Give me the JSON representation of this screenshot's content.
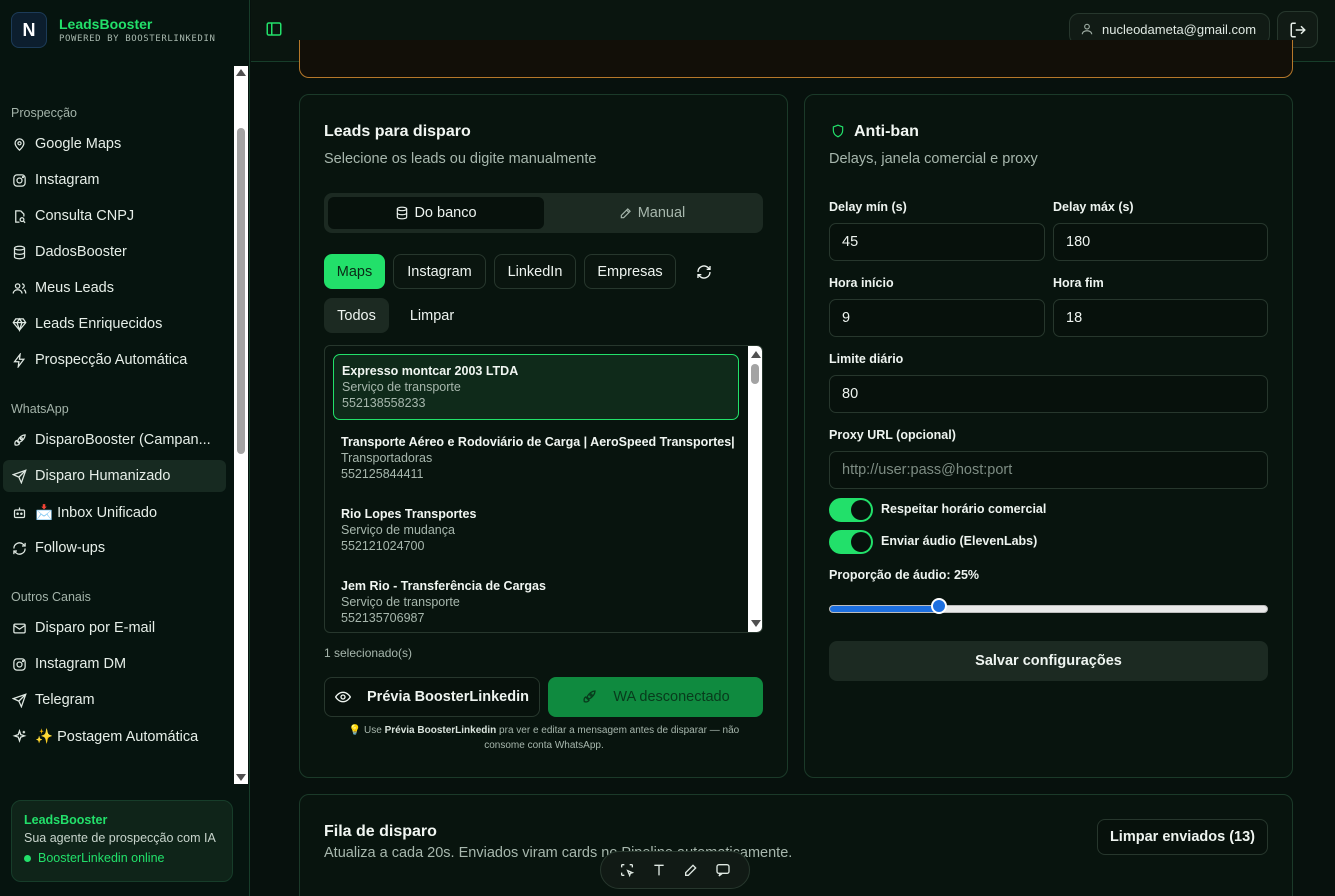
{
  "brand": {
    "logo_text": "N",
    "title": "LeadsBooster",
    "subtitle": "POWERED BY BOOSTERLINKEDIN"
  },
  "sidebar": {
    "sections": [
      {
        "label": "Prospecção",
        "items": [
          {
            "label": "Google Maps",
            "icon": "map-pin-icon"
          },
          {
            "label": "Instagram",
            "icon": "instagram-icon"
          },
          {
            "label": "Consulta CNPJ",
            "icon": "file-search-icon"
          },
          {
            "label": "DadosBooster",
            "icon": "database-icon"
          },
          {
            "label": "Meus Leads",
            "icon": "users-icon"
          },
          {
            "label": "Leads Enriquecidos",
            "icon": "gem-icon"
          },
          {
            "label": "Prospecção Automática",
            "icon": "zap-icon"
          }
        ]
      },
      {
        "label": "WhatsApp",
        "items": [
          {
            "label": "DisparoBooster (Campan...",
            "icon": "rocket-icon"
          },
          {
            "label": "Disparo Humanizado",
            "icon": "send-icon",
            "active": true
          },
          {
            "label": "📩 Inbox Unificado",
            "icon": "bot-icon"
          },
          {
            "label": "Follow-ups",
            "icon": "refresh-icon"
          }
        ]
      },
      {
        "label": "Outros Canais",
        "items": [
          {
            "label": "Disparo por E-mail",
            "icon": "mail-icon"
          },
          {
            "label": "Instagram DM",
            "icon": "instagram-icon"
          },
          {
            "label": "Telegram",
            "icon": "send-icon"
          },
          {
            "label": "✨ Postagem Automática",
            "icon": "sparkles-icon"
          }
        ]
      }
    ],
    "footer": {
      "title": "LeadsBooster",
      "text": "Sua agente de prospecção com IA",
      "status": "BoosterLinkedin online"
    }
  },
  "header": {
    "user_email": "nucleodameta@gmail.com"
  },
  "leads_card": {
    "title": "Leads para disparo",
    "subtitle": "Selecione os leads ou digite manualmente",
    "mode_db": "Do banco",
    "mode_manual": "Manual",
    "sources": [
      "Maps",
      "Instagram",
      "LinkedIn",
      "Empresas"
    ],
    "select_all": "Todos",
    "clear": "Limpar",
    "leads": [
      {
        "name": "Expresso montcar 2003 LTDA",
        "category": "Serviço de transporte",
        "phone": "552138558233",
        "selected": true
      },
      {
        "name": "Transporte Aéreo e Rodoviário de Carga | AeroSpeed Transportes|",
        "category": "Transportadoras",
        "phone": "552125844411"
      },
      {
        "name": "Rio Lopes Transportes",
        "category": "Serviço de mudança",
        "phone": "552121024700"
      },
      {
        "name": "Jem Rio - Transferência de Cargas",
        "category": "Serviço de transporte",
        "phone": "552135706987"
      }
    ],
    "selected_count": "1 selecionado(s)",
    "preview_button": "Prévia BoosterLinkedin",
    "send_button": "WA desconectado",
    "hint_prefix": "💡 Use ",
    "hint_bold": "Prévia BoosterLinkedin",
    "hint_suffix": " pra ver e editar a mensagem antes de disparar — não consome conta WhatsApp."
  },
  "antiban_card": {
    "title": "Anti-ban",
    "subtitle": "Delays, janela comercial e proxy",
    "delay_min_label": "Delay mín (s)",
    "delay_min_value": "45",
    "delay_max_label": "Delay máx (s)",
    "delay_max_value": "180",
    "hour_start_label": "Hora início",
    "hour_start_value": "9",
    "hour_end_label": "Hora fim",
    "hour_end_value": "18",
    "daily_limit_label": "Limite diário",
    "daily_limit_value": "80",
    "proxy_label": "Proxy URL (opcional)",
    "proxy_placeholder": "http://user:pass@host:port",
    "toggle_business_hours": "Respeitar horário comercial",
    "toggle_audio": "Enviar áudio (ElevenLabs)",
    "audio_ratio_label": "Proporção de áudio: 25%",
    "audio_ratio": 0.25,
    "save_button": "Salvar configurações"
  },
  "queue_card": {
    "title": "Fila de disparo",
    "subtitle": "Atualiza a cada 20s. Enviados viram cards no Pipeline automaticamente.",
    "clear_button": "Limpar enviados (13)"
  },
  "colors": {
    "accent": "#22e06a",
    "background": "#07110d",
    "warning_border": "#b6782a",
    "slider": "#1d6fe0"
  }
}
